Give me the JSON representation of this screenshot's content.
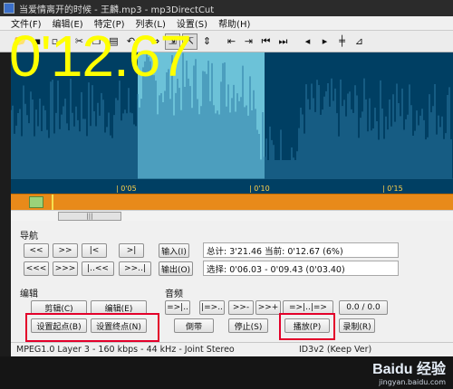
{
  "window": {
    "title": "当爱情离开的时候 - 王麟.mp3 - mp3DirectCut"
  },
  "menu": [
    "文件(F)",
    "编辑(E)",
    "特定(P)",
    "列表(L)",
    "设置(S)",
    "帮助(H)"
  ],
  "toolbar_icons": [
    "folder-icon",
    "save-icon",
    "save-all-icon",
    "cut-icon",
    "copy-icon",
    "paste-icon",
    "undo-icon",
    "zoom-fit-icon",
    "zoom-in-icon",
    "zoom-out-icon",
    "zoom-sel-icon",
    "set-begin-icon",
    "set-end-icon",
    "goto-begin-icon",
    "goto-end-icon",
    "mark-in-icon",
    "mark-out-icon",
    "split-icon",
    "fade-icon"
  ],
  "waveform": {
    "time_display": "0'12.67",
    "ticks": [
      "| 0'05",
      "| 0'10",
      "| 0'15"
    ],
    "colors": {
      "background": "#003f63",
      "wave": "#2d7aa3",
      "selection": "#7fd9ec",
      "time": "#ffff00"
    }
  },
  "scroll": {
    "thumb_label": "|||"
  },
  "nav": {
    "title": "导航",
    "row1": [
      "<<",
      ">>",
      "|<",
      ">|"
    ],
    "row2": [
      "<<<",
      ">>>",
      "|..<<",
      ">>..|"
    ],
    "in_button": "输入(I)",
    "out_button": "输出(O)",
    "total_field": "总计:  3'21.46   当前:  0'12.67   (6%)",
    "selection_field": "选择:  0'06.03 - 0'09.43 (0'03.40)"
  },
  "edit": {
    "title": "编辑",
    "cut_button": "剪辑(C)",
    "edit_button": "编辑(E)",
    "set_start_button": "设置起点(B)",
    "set_end_button": "设置终点(N)"
  },
  "audio": {
    "title": "音频",
    "row1": [
      "=>|..",
      "|=>..",
      ">>-",
      ">>+",
      "=>|..|=>",
      "0.0 / 0.0"
    ],
    "rewind_button": "倒带",
    "stop_button": "停止(S)",
    "play_button": "播放(P)",
    "record_button": "录制(R)"
  },
  "status": {
    "left": "MPEG1.0 Layer 3 - 160 kbps - 44 kHz - Joint Stereo",
    "right": "ID3v2 (Keep Ver)"
  },
  "watermark": {
    "main": "Baidu 经验",
    "sub": "jingyan.baidu.com"
  }
}
